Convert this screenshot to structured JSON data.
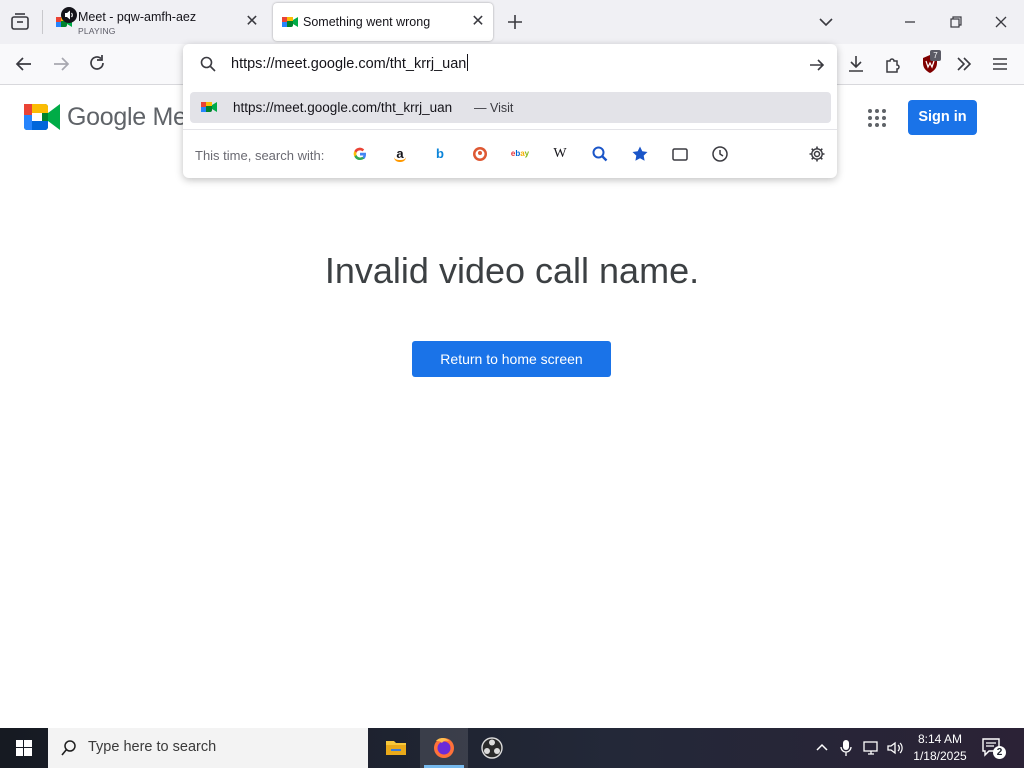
{
  "browser": {
    "tabs": [
      {
        "title": "Meet - pqw-amfh-aez",
        "status": "PLAYING"
      },
      {
        "title": "Something went wrong"
      }
    ],
    "address_bar": {
      "value": "https://meet.google.com/tht_krrj_uan",
      "suggestion_url": "https://meet.google.com/tht_krrj_uan",
      "suggestion_action": "— Visit",
      "search_with_label": "This time, search with:",
      "search_engines": [
        "google-icon",
        "amazon-icon",
        "bing-icon",
        "duckduckgo-icon",
        "ebay-icon",
        "wikipedia-icon",
        "search-icon",
        "bookmarks-icon",
        "tabs-icon",
        "history-icon"
      ]
    },
    "extension_badge": "7"
  },
  "page": {
    "logo_text": "Google Meet",
    "sign_in_label": "Sign in",
    "headline": "Invalid video call name.",
    "return_button_label": "Return to home screen"
  },
  "taskbar": {
    "search_placeholder": "Type here to search",
    "time": "8:14 AM",
    "date": "1/18/2025",
    "notification_count": "2"
  },
  "colors": {
    "accent": "#1a73e8",
    "headline": "#3c4043"
  }
}
